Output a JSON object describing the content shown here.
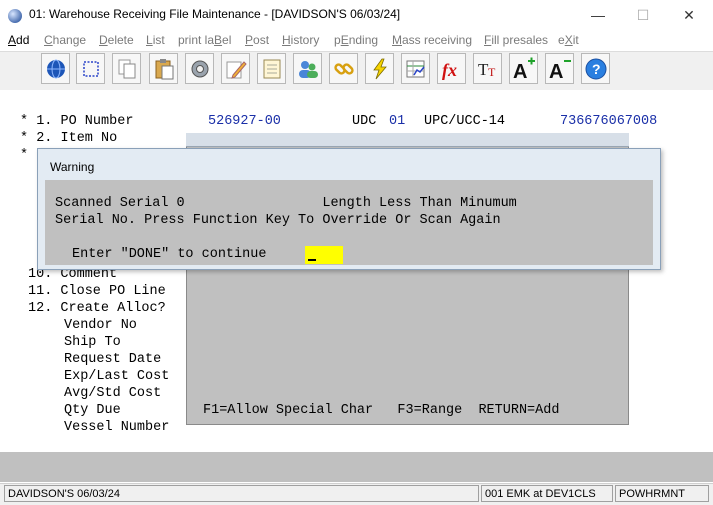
{
  "window": {
    "title": "01: Warehouse Receiving File Maintenance - [DAVIDSON'S 06/03/24]",
    "minimize": "—",
    "maximize": "☐",
    "close": "✕"
  },
  "menu": [
    {
      "text": "Add",
      "hot": "A",
      "rest": "dd"
    },
    {
      "pre": "",
      "hot": "C",
      "rest": "hange"
    },
    {
      "pre": "",
      "hot": "D",
      "rest": "elete"
    },
    {
      "pre": "",
      "hot": "L",
      "rest": "ist"
    },
    {
      "pre": "print la",
      "hot": "B",
      "rest": "el"
    },
    {
      "pre": "",
      "hot": "P",
      "rest": "ost"
    },
    {
      "pre": "",
      "hot": "H",
      "rest": "istory"
    },
    {
      "pre": "p",
      "hot": "E",
      "rest": "nding"
    },
    {
      "pre": "",
      "hot": "M",
      "rest": "ass receiving"
    },
    {
      "pre": "",
      "hot": "F",
      "rest": "ill presales"
    },
    {
      "pre": "e",
      "hot": "X",
      "rest": "it"
    }
  ],
  "toolbar": [
    "globe-icon",
    "select-icon",
    "copy-icon",
    "paste-icon",
    "settings-icon",
    "edit-icon",
    "notes-icon",
    "users-icon",
    "link-icon",
    "lightning-icon",
    "spreadsheet-icon",
    "function-icon",
    "font-size-icon",
    "font-increase-icon",
    "font-decrease-icon",
    "help-icon"
  ],
  "fields": {
    "f1": "* 1. PO Number",
    "f1_value": "526927-00",
    "udc_label": "UDC",
    "udc_value": "01",
    "upc_label": "UPC/UCC-14",
    "upc_value": "736676067008",
    "f2": "* 2. Item No",
    "f3_star": "*",
    "f10": "10. Comment",
    "f11": "11. Close PO Line",
    "f12": "12. Create Alloc?",
    "vendor": "Vendor No",
    "ship": "Ship To",
    "request": "Request Date",
    "explast": "Exp/Last Cost",
    "avgstd": "Avg/Std Cost",
    "qtydue": "Qty Due",
    "vessel": "Vessel Number"
  },
  "inner_popup": {
    "help": "F1=Allow Special Char   F3=Range  RETURN=Add"
  },
  "warning": {
    "title": "Warning",
    "line1": "Scanned Serial 0                 Length Less Than Minumum",
    "line2": "Serial No. Press Function Key To Override Or Scan Again",
    "prompt": "Enter \"DONE\" to continue",
    "input_value": ""
  },
  "status": {
    "company": "DAVIDSON'S 06/03/24",
    "session": "001 EMK at DEV1CLS",
    "program": "POWHRMNT"
  }
}
